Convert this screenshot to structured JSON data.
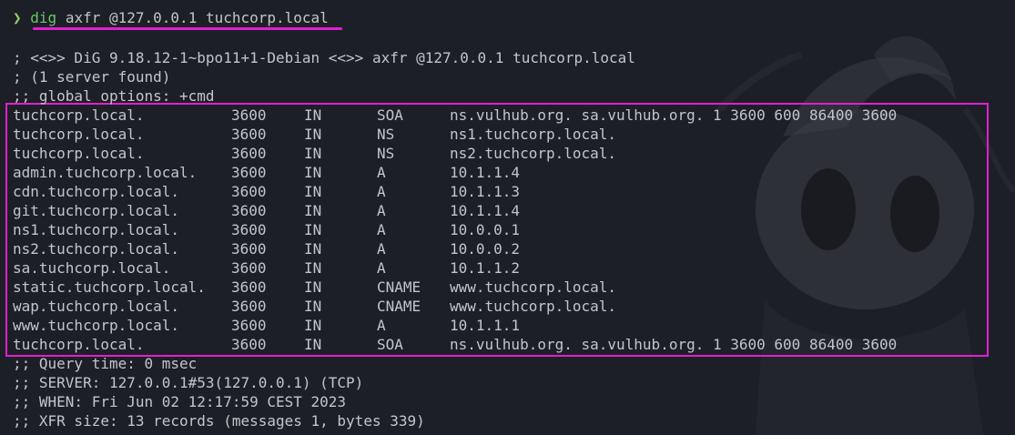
{
  "prompt": {
    "symbol": "❯",
    "command": "dig",
    "args": "axfr @127.0.0.1 tuchcorp.local"
  },
  "header_lines": [
    "; <<>> DiG 9.18.12-1~bpo11+1-Debian <<>> axfr @127.0.0.1 tuchcorp.local",
    "; (1 server found)",
    ";; global options: +cmd"
  ],
  "records": [
    {
      "name": "tuchcorp.local.",
      "ttl": "3600",
      "class": "IN",
      "type": "SOA",
      "data": "ns.vulhub.org. sa.vulhub.org. 1 3600 600 86400 3600"
    },
    {
      "name": "tuchcorp.local.",
      "ttl": "3600",
      "class": "IN",
      "type": "NS",
      "data": "ns1.tuchcorp.local."
    },
    {
      "name": "tuchcorp.local.",
      "ttl": "3600",
      "class": "IN",
      "type": "NS",
      "data": "ns2.tuchcorp.local."
    },
    {
      "name": "admin.tuchcorp.local.",
      "ttl": "3600",
      "class": "IN",
      "type": "A",
      "data": "10.1.1.4"
    },
    {
      "name": "cdn.tuchcorp.local.",
      "ttl": "3600",
      "class": "IN",
      "type": "A",
      "data": "10.1.1.3"
    },
    {
      "name": "git.tuchcorp.local.",
      "ttl": "3600",
      "class": "IN",
      "type": "A",
      "data": "10.1.1.4"
    },
    {
      "name": "ns1.tuchcorp.local.",
      "ttl": "3600",
      "class": "IN",
      "type": "A",
      "data": "10.0.0.1"
    },
    {
      "name": "ns2.tuchcorp.local.",
      "ttl": "3600",
      "class": "IN",
      "type": "A",
      "data": "10.0.0.2"
    },
    {
      "name": "sa.tuchcorp.local.",
      "ttl": "3600",
      "class": "IN",
      "type": "A",
      "data": "10.1.1.2"
    },
    {
      "name": "static.tuchcorp.local.",
      "ttl": "3600",
      "class": "IN",
      "type": "CNAME",
      "data": "www.tuchcorp.local."
    },
    {
      "name": "wap.tuchcorp.local.",
      "ttl": "3600",
      "class": "IN",
      "type": "CNAME",
      "data": "www.tuchcorp.local."
    },
    {
      "name": "www.tuchcorp.local.",
      "ttl": "3600",
      "class": "IN",
      "type": "A",
      "data": "10.1.1.1"
    },
    {
      "name": "tuchcorp.local.",
      "ttl": "3600",
      "class": "IN",
      "type": "SOA",
      "data": "ns.vulhub.org. sa.vulhub.org. 1 3600 600 86400 3600"
    }
  ],
  "footer_lines": [
    ";; Query time: 0 msec",
    ";; SERVER: 127.0.0.1#53(127.0.0.1) (TCP)",
    ";; WHEN: Fri Jun 02 12:17:59 CEST 2023",
    ";; XFR size: 13 records (messages 1, bytes 339)"
  ],
  "colors": {
    "background": "#1d1f26",
    "text": "#c2c5cc",
    "command": "#6ac46a",
    "highlight": "#e020d0"
  }
}
